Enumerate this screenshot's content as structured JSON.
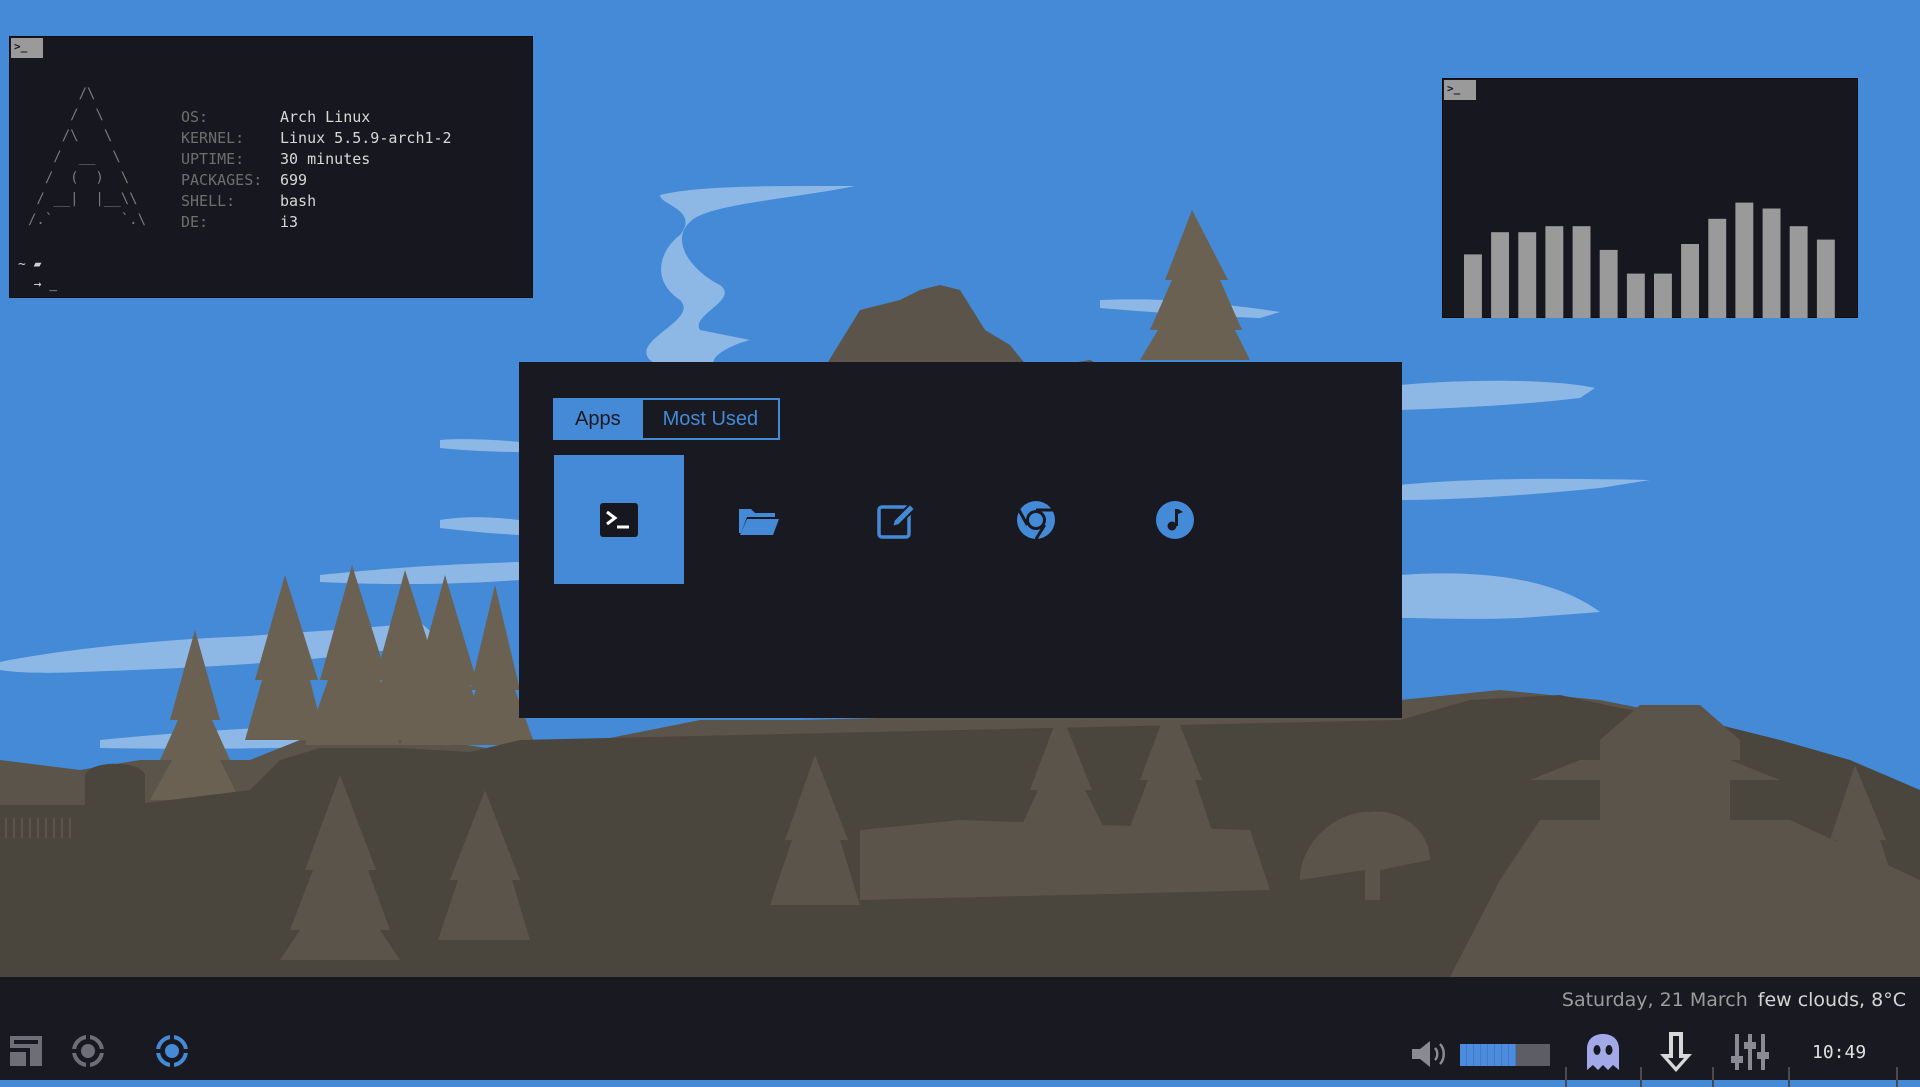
{
  "terminal_neofetch": {
    "tag": ">_",
    "ascii_art": "      /\\\n     /  \\\n    /\\   \\\n   /  __  \\\n  /  (  )  \\\n / __|  |__\\\\\n/.`        `.\\",
    "info": [
      {
        "key": "OS:",
        "value": "Arch Linux"
      },
      {
        "key": "KERNEL:",
        "value": "Linux 5.5.9-arch1-2"
      },
      {
        "key": "UPTIME:",
        "value": "30 minutes"
      },
      {
        "key": "PACKAGES:",
        "value": "699"
      },
      {
        "key": "SHELL:",
        "value": "bash"
      },
      {
        "key": "DE:",
        "value": "i3"
      }
    ],
    "prompt_line1": "~ ▰",
    "prompt_line2": "  → _"
  },
  "terminal_visualizer": {
    "tag": ">_",
    "bar_levels": [
      0.43,
      0.58,
      0.58,
      0.62,
      0.62,
      0.46,
      0.3,
      0.3,
      0.5,
      0.67,
      0.78,
      0.74,
      0.62,
      0.53
    ]
  },
  "launcher": {
    "tabs": [
      {
        "label": "Apps",
        "active": true
      },
      {
        "label": "Most Used",
        "active": false
      }
    ],
    "apps": [
      {
        "icon": "terminal-icon",
        "selected": true
      },
      {
        "icon": "folder-icon",
        "selected": false
      },
      {
        "icon": "edit-icon",
        "selected": false
      },
      {
        "icon": "chrome-icon",
        "selected": false
      },
      {
        "icon": "music-icon",
        "selected": false
      }
    ]
  },
  "panel": {
    "date": "Saturday, 21 March",
    "weather": "few clouds, 8°C",
    "clock": "10:49",
    "volume_level": 0.62,
    "left_icons": [
      "layout-icon",
      "workspace-icon",
      "active-workspace-icon"
    ],
    "right_icons": [
      "volume-icon",
      "ghost-icon",
      "download-icon",
      "mixer-icon"
    ]
  },
  "colors": {
    "accent": "#448ad6",
    "panel_bg": "#191922",
    "terrain": "#4a453d"
  }
}
